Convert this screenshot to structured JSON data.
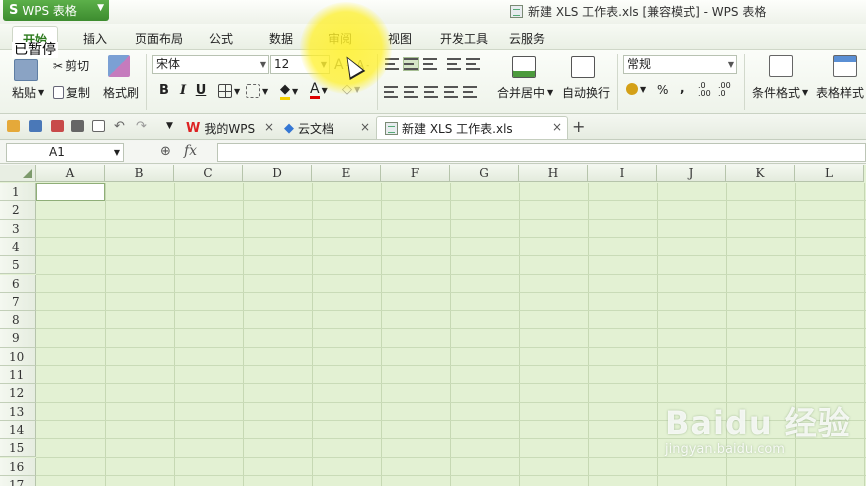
{
  "app": {
    "name": "WPS 表格",
    "logo": "S",
    "window_title": "新建 XLS 工作表.xls [兼容模式] - WPS 表格",
    "overlay_text": "已暂停"
  },
  "tabs": [
    "开始",
    "插入",
    "页面布局",
    "公式",
    "数据",
    "审阅",
    "视图",
    "开发工具",
    "云服务"
  ],
  "ribbon": {
    "paste": "粘贴",
    "cut": "剪切",
    "copy": "复制",
    "format_painter": "格式刷",
    "font_name": "宋体",
    "font_size": "12",
    "bold": "B",
    "italic": "I",
    "underline": "U",
    "merge_center": "合并居中",
    "wrap_text": "自动换行",
    "number_format": "常规",
    "percent": "%",
    "comma": ",",
    "inc_decimal": ".0\n.00",
    "conditional_format": "条件格式",
    "table_style": "表格样式"
  },
  "doc_tabs": [
    {
      "label": "我的WPS"
    },
    {
      "label": "云文档"
    },
    {
      "label": "新建 XLS 工作表.xls"
    }
  ],
  "formula_bar": {
    "cell_ref": "A1",
    "fx": "fx",
    "value": ""
  },
  "columns": [
    "A",
    "B",
    "C",
    "D",
    "E",
    "F",
    "G",
    "H",
    "I",
    "J",
    "K",
    "L"
  ],
  "rows": [
    "1",
    "2",
    "3",
    "4",
    "5",
    "6",
    "7",
    "8",
    "9",
    "10",
    "11",
    "12",
    "13",
    "14",
    "15",
    "16",
    "17"
  ],
  "watermark": {
    "brand": "Baidu 经验",
    "url": "jingyan.baidu.com"
  },
  "colors": {
    "accent_green": "#3d8c2f",
    "grid_bg": "#e3f1d3",
    "highlight": "#fff028"
  }
}
